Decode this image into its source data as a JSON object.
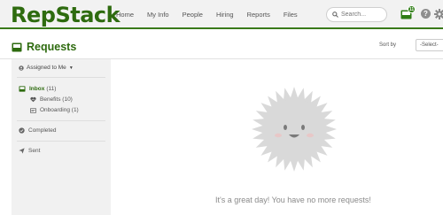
{
  "app": {
    "logo": "RepStack"
  },
  "nav": {
    "items": [
      "Home",
      "My Info",
      "People",
      "Hiring",
      "Reports",
      "Files"
    ]
  },
  "search": {
    "placeholder": "Search..."
  },
  "header_icons": {
    "inbox_badge": "11",
    "help": "?"
  },
  "page": {
    "title": "Requests",
    "sort_label": "Sort by",
    "sort_value": "-Select-"
  },
  "sidebar": {
    "filter": "Assigned to Me",
    "inbox": {
      "label": "Inbox",
      "count": "(11)"
    },
    "sub_items": [
      {
        "label": "Benefits (10)",
        "icon": "heart-icon"
      },
      {
        "label": "Onboarding (1)",
        "icon": "id-card-icon"
      }
    ],
    "completed": "Completed",
    "sent": "Sent"
  },
  "empty_state": {
    "message": "It's a great day! You have no more requests!"
  },
  "colors": {
    "brand": "#2e6b0f",
    "accent_bar": "#3a7a1a",
    "sun": "#d9d9d9"
  }
}
